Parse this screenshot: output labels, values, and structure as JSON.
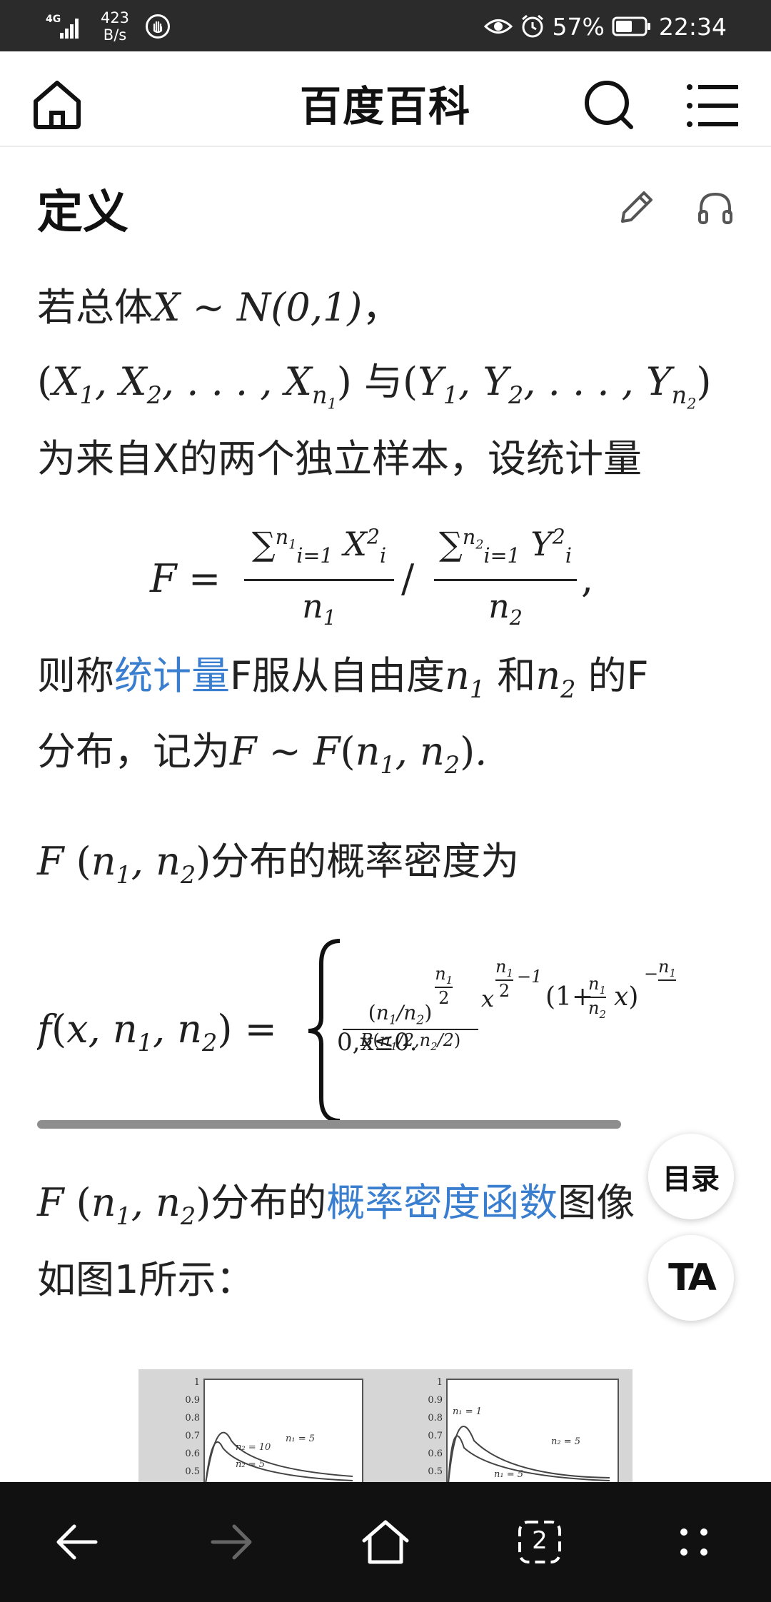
{
  "status_bar": {
    "network": "4G",
    "data_rate": "423\nB/s",
    "battery": "57%",
    "time": "22:34"
  },
  "header": {
    "title": "百度百科",
    "icons": [
      "home-icon",
      "search-icon",
      "menu-icon"
    ]
  },
  "section": {
    "title": "定义"
  },
  "paragraph1": {
    "line1_prefix": "若总体",
    "line1_math": "X ∼ N(0,1)",
    "line1_suffix": "，",
    "line2_and": "与",
    "line3": "为来自X的两个独立样本，设统计量"
  },
  "paragraph2": {
    "prefix": "则称",
    "link": "统计量",
    "middle": "F服从自由度",
    "and": "和",
    "suffix": "的F",
    "line2_prefix": "分布，记为"
  },
  "paragraph3": {
    "suffix": "分布的概率密度为",
    "piecewise_lower": "0,x≤0."
  },
  "paragraph4": {
    "middle": "分布的",
    "link": "概率密度函数",
    "tail": "图像",
    "line2": "如图1所示："
  },
  "fabs": {
    "toc_label": "目录",
    "ta_label": "TA"
  },
  "figure": {
    "left_panel": {
      "y_ticks": [
        "1",
        "0.9",
        "0.8",
        "0.7",
        "0.6",
        "0.5"
      ],
      "labels": [
        "n₂ = 10",
        "n₂ = 5",
        "n₁ = 5"
      ]
    },
    "right_panel": {
      "y_ticks": [
        "1",
        "0.9",
        "0.8",
        "0.7",
        "0.6",
        "0.5"
      ],
      "labels": [
        "n₁ = 1",
        "n₂ = 5",
        "n₁ = 5"
      ]
    }
  },
  "bottom_nav": {
    "tab_count": "2",
    "icons": [
      "back-icon",
      "forward-icon",
      "home-icon",
      "tabs-icon",
      "more-icon"
    ]
  }
}
